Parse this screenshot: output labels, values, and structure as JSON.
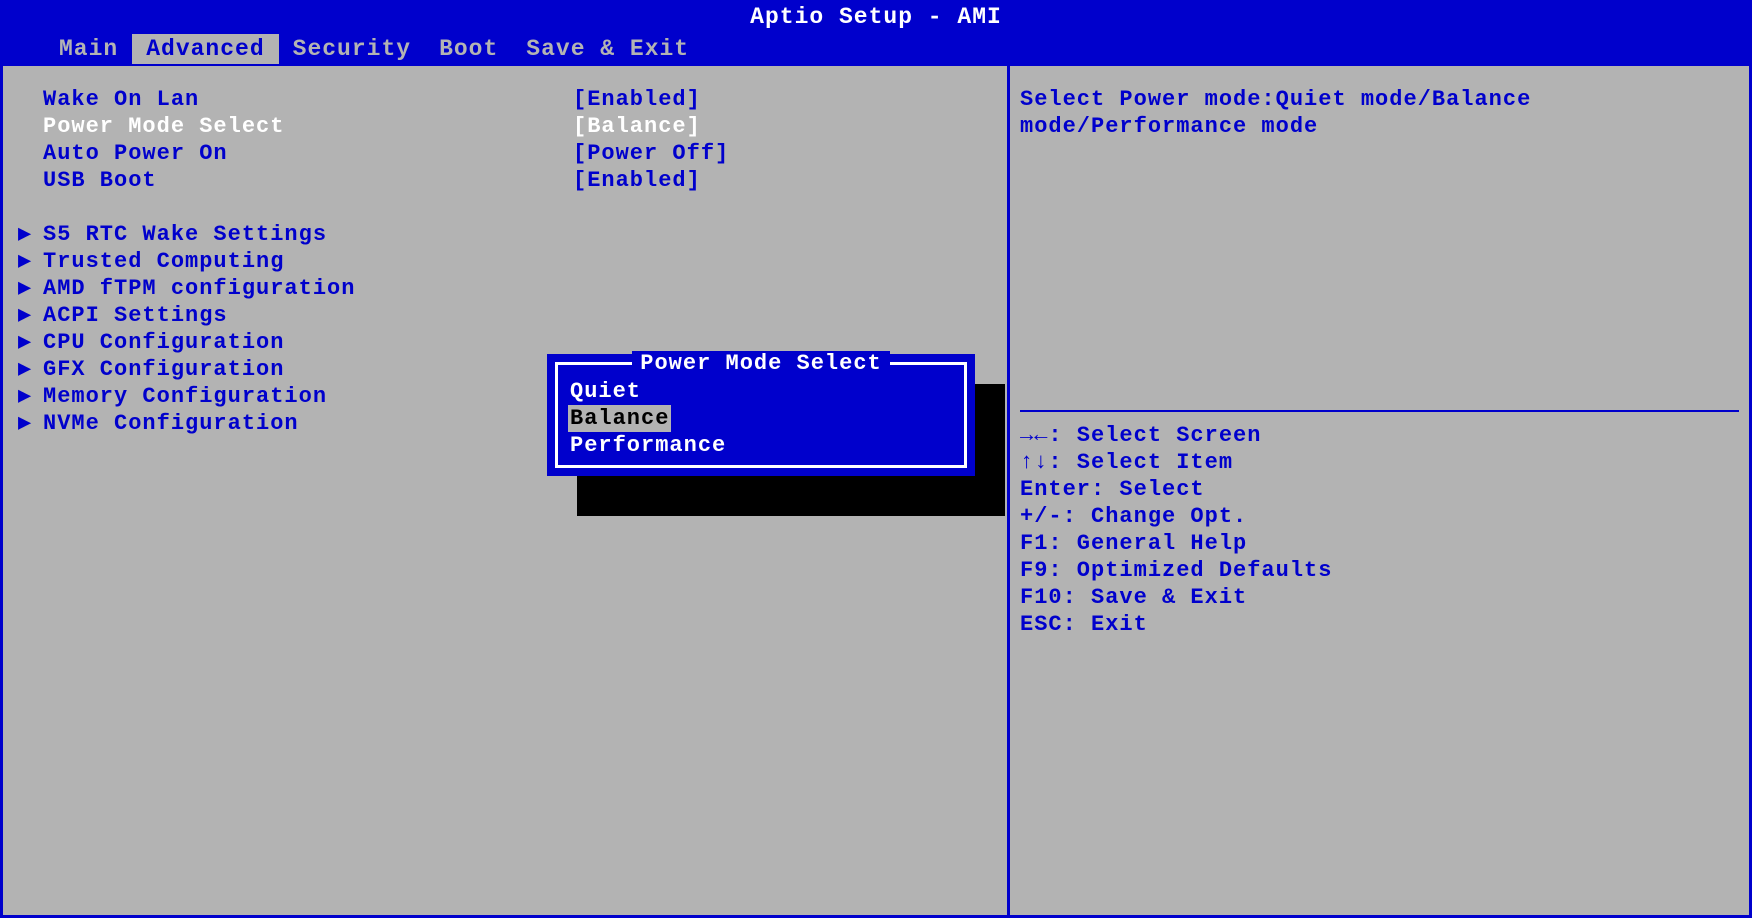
{
  "header": {
    "title": "Aptio Setup - AMI",
    "tabs": [
      "Main",
      "Advanced",
      "Security",
      "Boot",
      "Save & Exit"
    ],
    "active_tab": "Advanced"
  },
  "settings": [
    {
      "label": "Wake On Lan",
      "value": "[Enabled]",
      "selected": false
    },
    {
      "label": "Power Mode Select",
      "value": "[Balance]",
      "selected": true
    },
    {
      "label": "Auto Power On",
      "value": "[Power Off]",
      "selected": false
    },
    {
      "label": "USB Boot",
      "value": "[Enabled]",
      "selected": false
    }
  ],
  "submenus": [
    "S5 RTC Wake Settings",
    "Trusted Computing",
    "AMD fTPM configuration",
    "ACPI Settings",
    "CPU Configuration",
    "GFX Configuration",
    "Memory Configuration",
    "NVMe Configuration"
  ],
  "help": {
    "text": "Select Power mode:Quiet mode/Balance mode/Performance mode"
  },
  "keyhelp": [
    "→←: Select Screen",
    "↑↓: Select Item",
    "Enter: Select",
    "+/-: Change Opt.",
    "F1: General Help",
    "F9: Optimized Defaults",
    "F10: Save & Exit",
    "ESC: Exit"
  ],
  "popup": {
    "title": "Power Mode Select",
    "options": [
      "Quiet",
      "Balance",
      "Performance"
    ],
    "selected": "Balance"
  },
  "arrow": "▶"
}
